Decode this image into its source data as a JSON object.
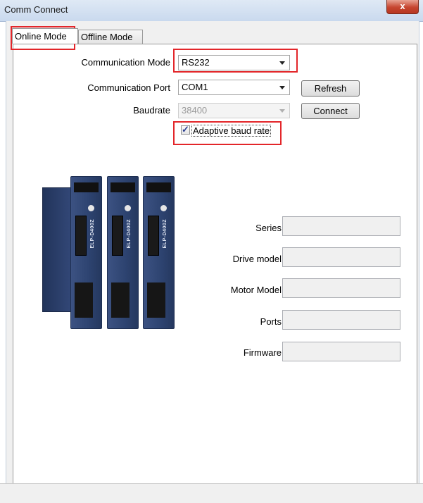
{
  "window": {
    "title": "Comm Connect",
    "close_glyph": "x"
  },
  "tabs": [
    {
      "label": "Online Mode",
      "active": true
    },
    {
      "label": "Offline Mode",
      "active": false
    }
  ],
  "form": {
    "communication_mode": {
      "label": "Communication Mode",
      "value": "RS232"
    },
    "communication_port": {
      "label": "Communication Port",
      "value": "COM1"
    },
    "baudrate": {
      "label": "Baudrate",
      "value": "38400",
      "enabled": false
    },
    "adaptive_baud": {
      "label": "Adaptive baud rate",
      "checked": true
    }
  },
  "buttons": {
    "refresh": "Refresh",
    "connect": "Connect"
  },
  "info": {
    "series": {
      "label": "Series",
      "value": ""
    },
    "drive_model": {
      "label": "Drive model",
      "value": ""
    },
    "motor_model": {
      "label": "Motor Model",
      "value": ""
    },
    "ports": {
      "label": "Ports",
      "value": ""
    },
    "firmware": {
      "label": "Firmware",
      "value": ""
    }
  },
  "drive_image": {
    "model_text": "ELP-D400Z"
  },
  "colors": {
    "highlight": "#e3262a",
    "drive_body": "#2d4370"
  }
}
